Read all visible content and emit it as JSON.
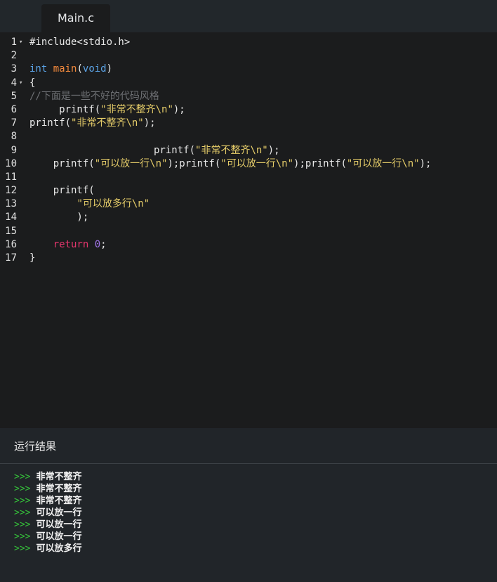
{
  "tab": {
    "filename": "Main.c"
  },
  "colors": {
    "keyword": "#5ba3e6",
    "function": "#f2893c",
    "string": "#e6cd69",
    "comment": "#6e7074",
    "return_keyword": "#e5366d",
    "number": "#a074e8",
    "prompt": "#35c03a",
    "editor_background": "#1b1c1d",
    "panel_background": "#212529"
  },
  "editor": {
    "lines": [
      {
        "number": "1",
        "fold": true,
        "tokens": [
          {
            "type": "plain",
            "text": "#include<stdio.h>"
          }
        ]
      },
      {
        "number": "2",
        "tokens": []
      },
      {
        "number": "3",
        "tokens": [
          {
            "type": "keyword",
            "text": "int"
          },
          {
            "type": "plain",
            "text": " "
          },
          {
            "type": "func",
            "text": "main"
          },
          {
            "type": "plain",
            "text": "("
          },
          {
            "type": "keyword",
            "text": "void"
          },
          {
            "type": "plain",
            "text": ")"
          }
        ]
      },
      {
        "number": "4",
        "fold": true,
        "tokens": [
          {
            "type": "plain",
            "text": "{"
          }
        ]
      },
      {
        "number": "5",
        "tokens": [
          {
            "type": "comment",
            "text": "//下面是一些不好的代码风格"
          }
        ]
      },
      {
        "number": "6",
        "tokens": [
          {
            "type": "plain",
            "text": "     printf("
          },
          {
            "type": "string",
            "text": "\"非常不整齐\\n\""
          },
          {
            "type": "plain",
            "text": ");"
          }
        ]
      },
      {
        "number": "7",
        "tokens": [
          {
            "type": "plain",
            "text": "printf("
          },
          {
            "type": "string",
            "text": "\"非常不整齐\\n\""
          },
          {
            "type": "plain",
            "text": ");"
          }
        ]
      },
      {
        "number": "8",
        "tokens": []
      },
      {
        "number": "9",
        "tokens": [
          {
            "type": "plain",
            "text": "                     printf("
          },
          {
            "type": "string",
            "text": "\"非常不整齐\\n\""
          },
          {
            "type": "plain",
            "text": ");"
          }
        ]
      },
      {
        "number": "10",
        "tokens": [
          {
            "type": "plain",
            "text": "    printf("
          },
          {
            "type": "string",
            "text": "\"可以放一行\\n\""
          },
          {
            "type": "plain",
            "text": ");printf("
          },
          {
            "type": "string",
            "text": "\"可以放一行\\n\""
          },
          {
            "type": "plain",
            "text": ");printf("
          },
          {
            "type": "string",
            "text": "\"可以放一行\\n\""
          },
          {
            "type": "plain",
            "text": ");"
          }
        ]
      },
      {
        "number": "11",
        "tokens": []
      },
      {
        "number": "12",
        "tokens": [
          {
            "type": "plain",
            "text": "    printf("
          }
        ]
      },
      {
        "number": "13",
        "tokens": [
          {
            "type": "plain",
            "text": "        "
          },
          {
            "type": "string",
            "text": "\"可以放多行\\n\""
          }
        ]
      },
      {
        "number": "14",
        "tokens": [
          {
            "type": "plain",
            "text": "        );"
          }
        ]
      },
      {
        "number": "15",
        "tokens": []
      },
      {
        "number": "16",
        "tokens": [
          {
            "type": "plain",
            "text": "    "
          },
          {
            "type": "return",
            "text": "return"
          },
          {
            "type": "plain",
            "text": " "
          },
          {
            "type": "number",
            "text": "0"
          },
          {
            "type": "plain",
            "text": ";"
          }
        ]
      },
      {
        "number": "17",
        "tokens": [
          {
            "type": "plain",
            "text": "}"
          }
        ]
      }
    ]
  },
  "result": {
    "title": "运行结果",
    "prompt": ">>>",
    "lines": [
      "非常不整齐",
      "非常不整齐",
      "非常不整齐",
      "可以放一行",
      "可以放一行",
      "可以放一行",
      "可以放多行"
    ]
  }
}
